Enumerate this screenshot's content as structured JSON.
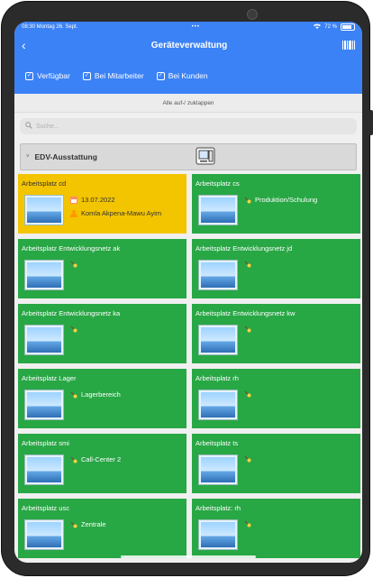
{
  "status_bar": {
    "time_date": "08:30 Montag 26. Sept.",
    "center": "•••",
    "battery": "72 %"
  },
  "navbar": {
    "title": "Geräteverwaltung",
    "back": "‹"
  },
  "filters": [
    {
      "label": "Verfügbar",
      "checked": true
    },
    {
      "label": "Bei Mitarbeiter",
      "checked": true
    },
    {
      "label": "Bei Kunden",
      "checked": true
    }
  ],
  "toggle_all": "Alle auf-/ zuklappen",
  "search": {
    "placeholder": "Suche..."
  },
  "section": {
    "title": "EDV-Ausstattung"
  },
  "tiles": [
    {
      "title": "Arbeitsplatz cd",
      "color": "yellow",
      "date": "13.07.2022",
      "person": "Komla Akpena-Mawu Ayim"
    },
    {
      "title": "Arbeitsplatz cs",
      "color": "green",
      "location": "Produktion/Schulung"
    },
    {
      "title": "Arbeitsplatz Entwicklungsnetz ak",
      "color": "green",
      "location": ""
    },
    {
      "title": "Arbeitsplatz Entwicklungsnetz jd",
      "color": "green",
      "location": ""
    },
    {
      "title": "Arbeitsplatz Entwicklungsnetz ka",
      "color": "green",
      "location": ""
    },
    {
      "title": "Arbeitsplatz Entwicklungsnetz kw",
      "color": "green",
      "location": ""
    },
    {
      "title": "Arbeitsplatz Lager",
      "color": "green",
      "location": "Lagerbereich"
    },
    {
      "title": "Arbeitsplatz rh",
      "color": "green",
      "location": ""
    },
    {
      "title": "Arbeitsplatz smi",
      "color": "green",
      "location": "Call-Center 2"
    },
    {
      "title": "Arbeitsplatz ts",
      "color": "green",
      "location": ""
    },
    {
      "title": "Arbeitsplatz usc",
      "color": "green",
      "location": "Zentrale"
    },
    {
      "title": "Arbeitsplatz: rh",
      "color": "green",
      "location": ""
    }
  ],
  "colors": {
    "primary": "#3b82f6",
    "green": "#28a745",
    "yellow": "#f3c400"
  }
}
